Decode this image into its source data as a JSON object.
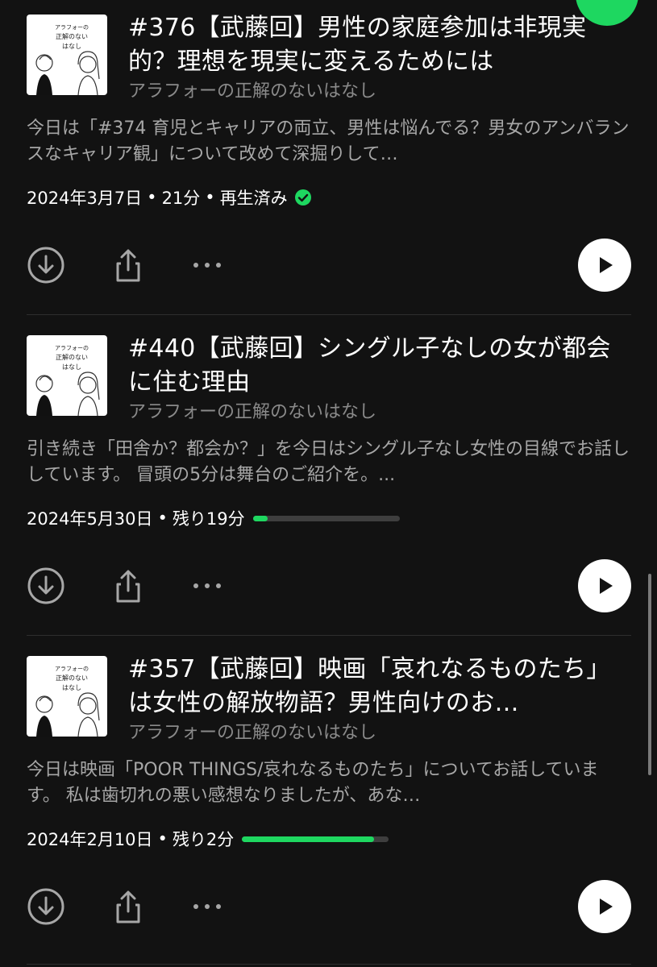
{
  "episodes": [
    {
      "title": "#376【武藤回】男性の家庭参加は非現実的？理想を現実に変えるためには",
      "show": "アラフォーの正解のないはなし",
      "description": "今日は「#374 育児とキャリアの両立、男性は悩んでる？男女のアンバランスなキャリア観」について改めて深掘りして…",
      "date": "2024年3月7日",
      "duration": "21分",
      "status": "再生済み",
      "played": true,
      "thumbnail_text": [
        "アラフォーの",
        "正解のない",
        "はなし"
      ]
    },
    {
      "title": "#440【武藤回】シングル子なしの女が都会に住む理由",
      "show": "アラフォーの正解のないはなし",
      "description": "引き続き「田舎か？都会か？」を今日はシングル子なし女性の目線でお話ししています。 冒頭の5分は舞台のご紹介を。...",
      "date": "2024年5月30日",
      "remaining": "残り19分",
      "progress": 0.1,
      "thumbnail_text": [
        "アラフォーの",
        "正解のない",
        "はなし"
      ]
    },
    {
      "title": "#357【武藤回】映画「哀れなるものたち」は女性の解放物語？男性向けのお…",
      "show": "アラフォーの正解のないはなし",
      "description": "今日は映画「POOR THINGS/哀れなるものたち」についてお話しています。 私は歯切れの悪い感想なりましたが、あな…",
      "date": "2024年2月10日",
      "remaining": "残り2分",
      "progress": 0.9,
      "thumbnail_text": [
        "アラフォーの",
        "正解のない",
        "はなし"
      ]
    }
  ],
  "meta_separator": "•",
  "icons": {
    "download": "download-circle-icon",
    "share": "share-icon",
    "more": "more-dots-icon",
    "play": "play-icon",
    "played": "check-circle-icon"
  },
  "colors": {
    "background": "#121212",
    "accent": "#1ed760",
    "text_primary": "#ffffff",
    "text_secondary": "#a7a7a7",
    "progress_track": "#3e3e3e"
  }
}
